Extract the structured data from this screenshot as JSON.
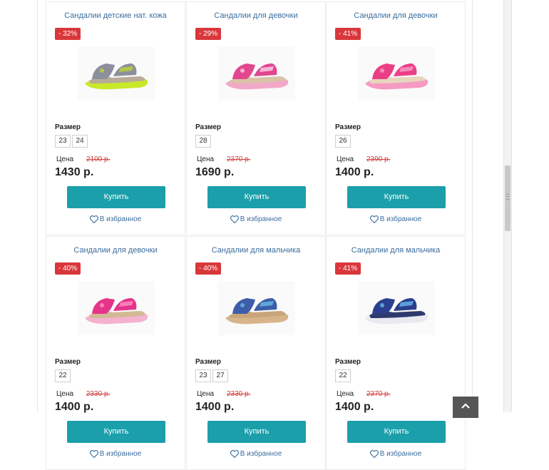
{
  "catalog": {
    "size_label": "Размер",
    "price_label": "Цена",
    "buy_label": "Купить",
    "favorite_label": "В избранное",
    "products": [
      {
        "title": "Сандалии детские нат. кожа",
        "discount": "- 32%",
        "sizes": [
          "23",
          "24"
        ],
        "old_price": "2100 р.",
        "price": "1430 р.",
        "image": "sandal-gray-lime"
      },
      {
        "title": "Сандалии для девочки",
        "discount": "- 29%",
        "sizes": [
          "28"
        ],
        "old_price": "2370 р.",
        "price": "1690 р.",
        "image": "sandal-pink-flower"
      },
      {
        "title": "Сандалии для девочки",
        "discount": "- 41%",
        "sizes": [
          "26"
        ],
        "old_price": "2390 р.",
        "price": "1400 р.",
        "image": "sandal-pink"
      },
      {
        "title": "Сандалии для девочки",
        "discount": "- 40%",
        "sizes": [
          "22"
        ],
        "old_price": "2330 р.",
        "price": "1400 р.",
        "image": "sandal-pink-magenta"
      },
      {
        "title": "Сандалии для мальчика",
        "discount": "- 40%",
        "sizes": [
          "23",
          "27"
        ],
        "old_price": "2330 р.",
        "price": "1400 р.",
        "image": "sandal-blue-pattern"
      },
      {
        "title": "Сандалии для мальчика",
        "discount": "- 41%",
        "sizes": [
          "22"
        ],
        "old_price": "2370 р.",
        "price": "1400 р.",
        "image": "sandal-navy"
      }
    ]
  },
  "colors": {
    "badge": "#d9373b",
    "button": "#1b9faa",
    "link": "#3b6d9e",
    "old_price": "#d23a3a"
  }
}
